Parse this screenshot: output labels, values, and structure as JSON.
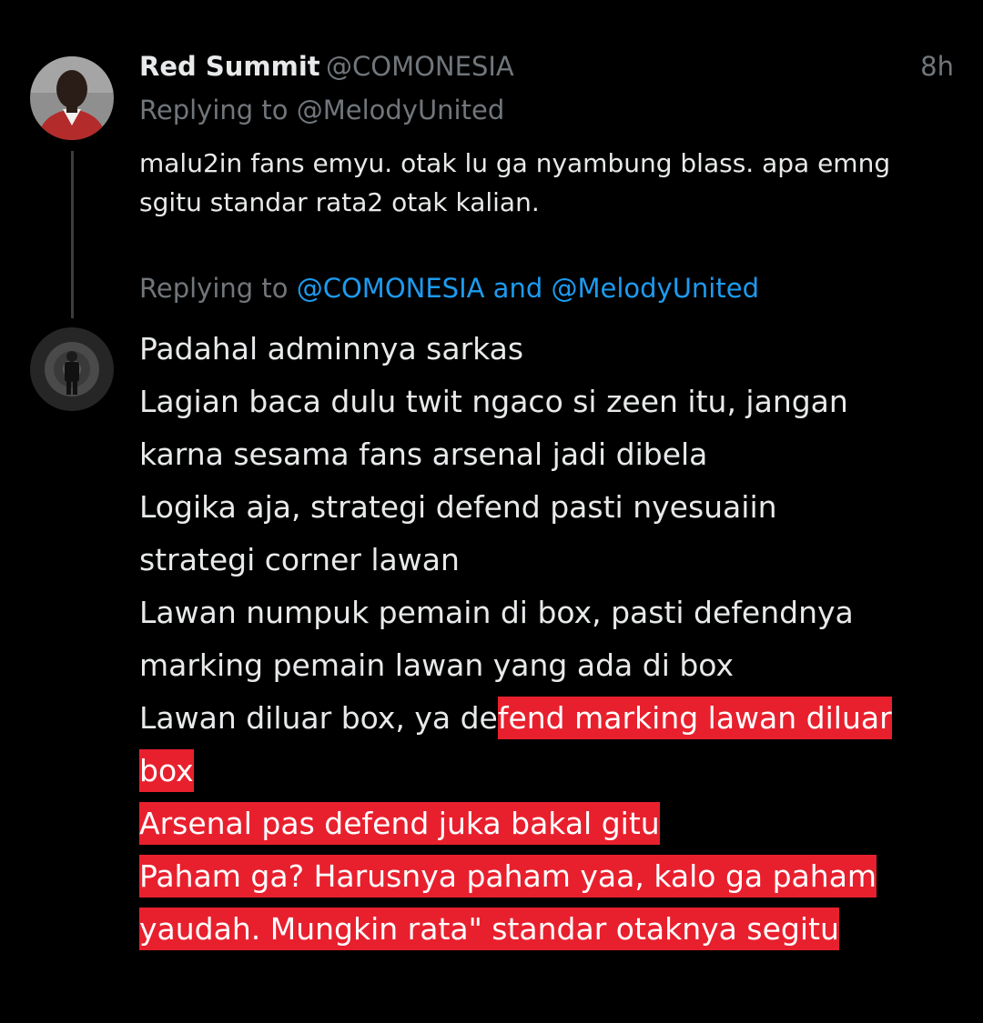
{
  "tweet1": {
    "display_name": "Red Summit",
    "handle": "@COMONESIA",
    "time": "8h",
    "replying_to": "Replying to @MelodyUnited",
    "text_lines": [
      "malu2in fans emyu. otak lu ga nyambung blass. apa emng",
      "sgitu standar rata2 otak kalian."
    ]
  },
  "tweet2": {
    "replying_prefix": "Replying to ",
    "mention_1": "@COMONESIA",
    "and": " and ",
    "mention_2": "@MelodyUnited",
    "lines": [
      "Padahal adminnya sarkas",
      "Lagian baca dulu twit ngaco si zeen itu, jangan",
      "karna sesama fans arsenal jadi dibela",
      "Logika aja, strategi defend pasti nyesuaiin",
      "strategi corner lawan",
      "Lawan numpuk pemain di box, pasti defendnya",
      "marking pemain lawan yang ada di box"
    ],
    "line8_plain": "Lawan diluar box, ya de",
    "line8_highlight": "fend marking lawan diluar",
    "highlight_lines": [
      "box",
      "Arsenal pas defend juka bakal gitu",
      "Paham ga? Harusnya paham yaa, kalo ga paham",
      "yaudah. Mungkin rata\" standar otaknya segitu"
    ]
  },
  "colors": {
    "background": "#000000",
    "text": "#e7e9ea",
    "muted": "#71767b",
    "mention": "#1d9bf0",
    "highlight": "#e8202e"
  }
}
